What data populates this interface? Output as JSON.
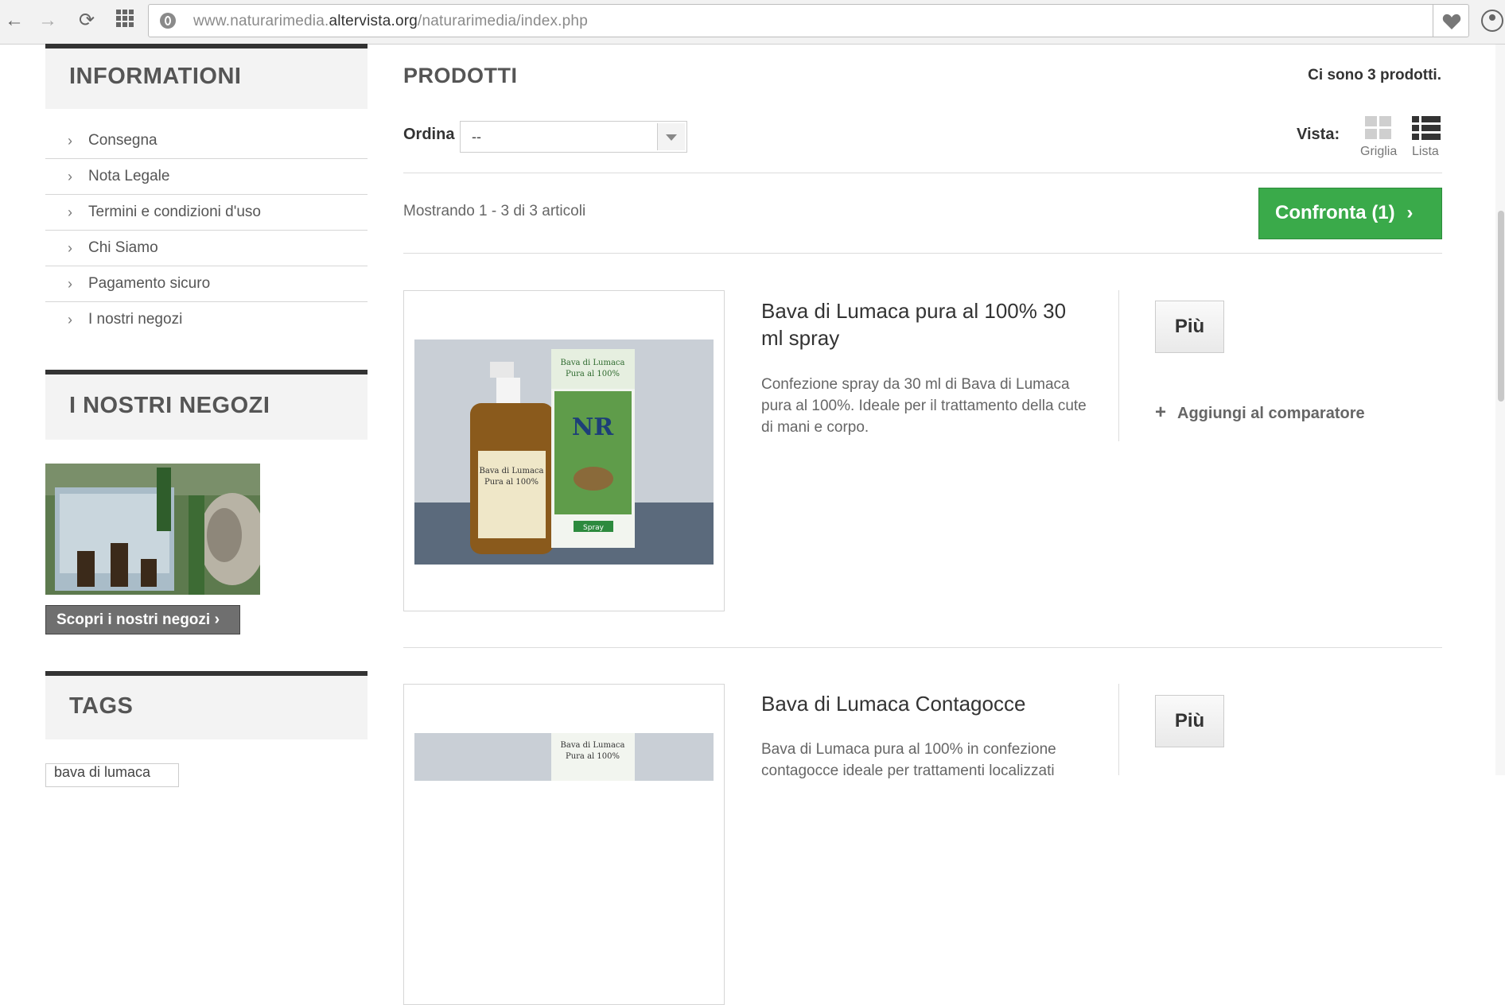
{
  "browser": {
    "url_prefix": "www.naturarimedia.",
    "url_domain": "altervista.org",
    "url_path": "/naturarimedia/index.php"
  },
  "sidebar": {
    "info_title": "INFORMATIONI",
    "info_items": [
      {
        "label": "Consegna"
      },
      {
        "label": "Nota Legale"
      },
      {
        "label": "Termini e condizioni d'uso"
      },
      {
        "label": "Chi Siamo"
      },
      {
        "label": "Pagamento sicuro"
      },
      {
        "label": "I nostri negozi"
      }
    ],
    "stores_title": "I NOSTRI NEGOZI",
    "stores_button": "Scopri i nostri negozi",
    "tags_title": "TAGS",
    "tag_first": "bava di lumaca"
  },
  "main": {
    "title": "PRODOTTI",
    "count_text": "Ci sono 3 prodotti.",
    "sort_label": "Ordina",
    "sort_value": "--",
    "view_label": "Vista:",
    "view_grid": "Griglia",
    "view_list": "Lista",
    "showing_text": "Mostrando 1 - 3 di 3 articoli",
    "compare_button": "Confronta (1)"
  },
  "products": [
    {
      "name": "Bava di Lumaca pura al 100% 30 ml spray",
      "description": "Confezione spray da 30 ml di Bava di Lumaca pura al 100%. Ideale per il trattamento della cute di mani e corpo.",
      "more_button": "Più",
      "add_compare": "Aggiungi al comparatore",
      "box_line1": "Bava di Lumaca",
      "box_line2": "Pura al 100%",
      "box_logo": "NR",
      "box_spray": "Spray"
    },
    {
      "name": "Bava di Lumaca Contagocce",
      "description": "Bava di Lumaca pura al 100% in confezione contagocce ideale per trattamenti localizzati",
      "more_button": "Più",
      "box_line1": "Bava di Lumaca",
      "box_line2": "Pura al 100%"
    }
  ],
  "colors": {
    "accent_green": "#3aaa4a",
    "dark_bar": "#333333"
  }
}
